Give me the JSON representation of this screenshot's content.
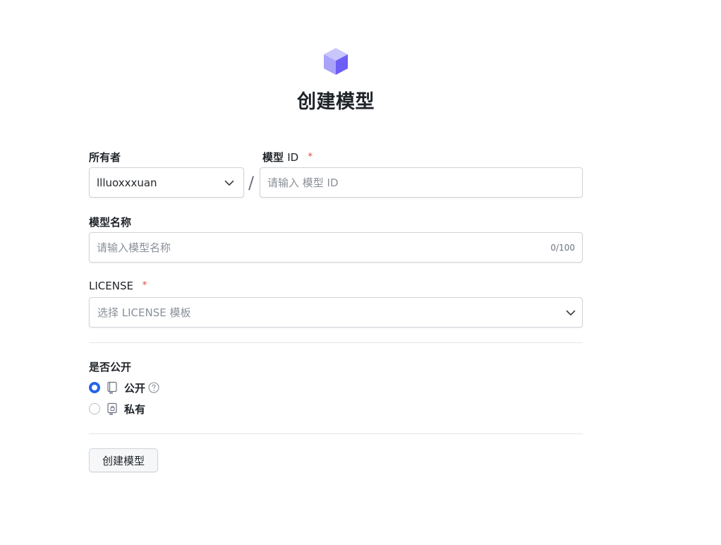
{
  "page": {
    "title": "创建模型",
    "logo_icon": "cube-icon"
  },
  "owner": {
    "label": "所有者",
    "value": "llluoxxxuan"
  },
  "separator": "/",
  "model_id": {
    "label": "模型",
    "label_suffix": "ID",
    "required_mark": "*",
    "placeholder": "请输入 模型 ID"
  },
  "model_name": {
    "label": "模型名称",
    "placeholder": "请输入模型名称",
    "counter": "0/100"
  },
  "license": {
    "label": "LICENSE",
    "required_mark": "*",
    "placeholder": "选择 LICENSE 模板"
  },
  "visibility": {
    "label": "是否公开",
    "options": [
      {
        "label": "公开",
        "icon": "repo-icon",
        "selected": true,
        "help_icon": "question-circle-icon"
      },
      {
        "label": "私有",
        "icon": "lock-repo-icon",
        "selected": false
      }
    ]
  },
  "submit": {
    "label": "创建模型"
  },
  "colors": {
    "accent": "#2563eb",
    "required": "#e0443e",
    "logo_light": "#b8b4fb",
    "logo_dark": "#6d5ef5"
  }
}
